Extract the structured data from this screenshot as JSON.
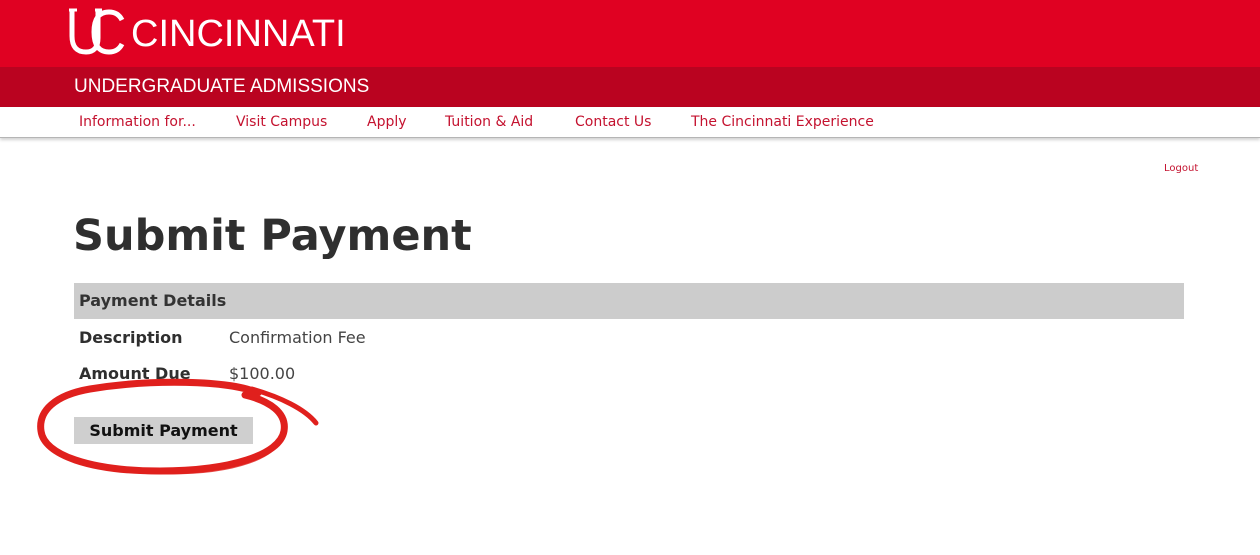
{
  "brand": {
    "name": "CINCINNATI",
    "logo_icon": "uc-logo-icon",
    "color": "#e00122"
  },
  "department": {
    "title": "UNDERGRADUATE ADMISSIONS",
    "color": "#ba0320"
  },
  "nav": {
    "items": [
      {
        "label": "Information for..."
      },
      {
        "label": "Visit Campus"
      },
      {
        "label": "Apply"
      },
      {
        "label": "Tuition & Aid"
      },
      {
        "label": "Contact Us"
      },
      {
        "label": "The Cincinnati Experience"
      }
    ],
    "color": "#c4122f"
  },
  "account": {
    "logout_label": "Logout"
  },
  "page": {
    "title": "Submit Payment"
  },
  "payment": {
    "section_title": "Payment Details",
    "rows": [
      {
        "label": "Description",
        "value": "Confirmation Fee"
      },
      {
        "label": "Amount Due",
        "value": "$100.00"
      }
    ],
    "submit_label": "Submit Payment"
  },
  "annotation": {
    "type": "hand-drawn-circle",
    "color": "#e0201d"
  }
}
